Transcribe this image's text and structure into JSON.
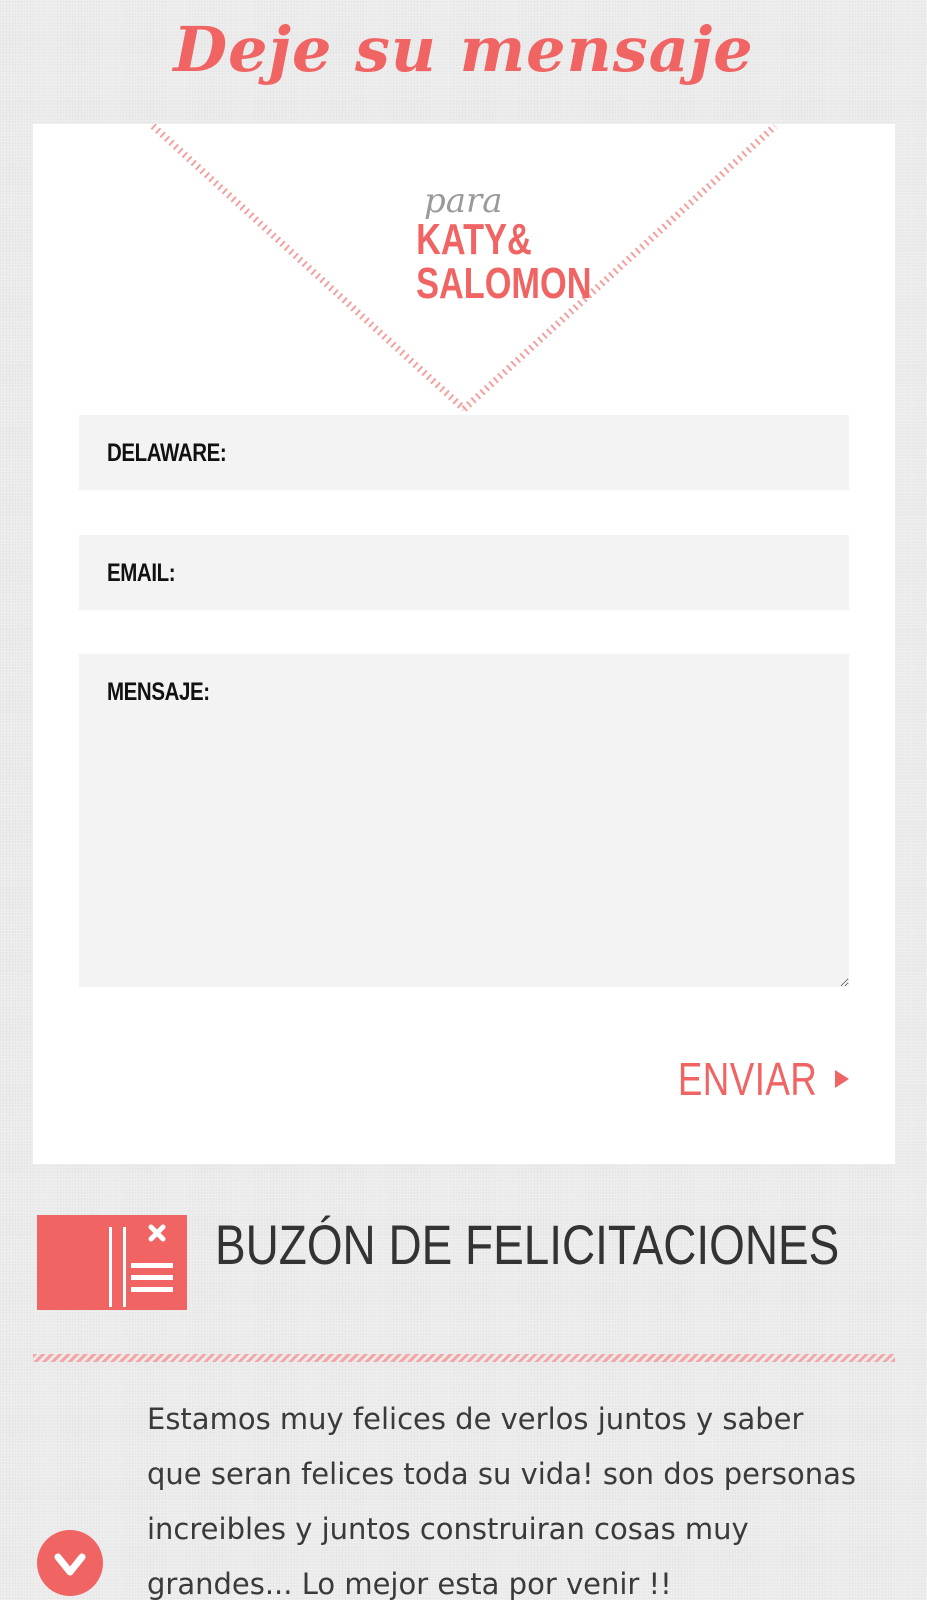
{
  "page": {
    "title": "Deje su mensaje"
  },
  "logo": {
    "para": "para",
    "line1": "KATY&",
    "line2": "SALOMON"
  },
  "form": {
    "name_label": "DELAWARE:",
    "email_label": "EMAIL:",
    "message_label": "MENSAJE:",
    "submit_label": "ENVIAR"
  },
  "mailbox": {
    "title": "BUZÓN DE FELICITACIONES",
    "icon": "mailbox-icon"
  },
  "messages": [
    {
      "text": "Estamos muy felices de verlos juntos y saber que seran felices toda su vida! son dos personas increibles y juntos construiran cosas muy grandes... Lo mejor esta por venir !!",
      "icon": "heart-icon"
    }
  ],
  "colors": {
    "accent": "#f06464",
    "field_bg": "#f3f3f3",
    "card_bg": "#ffffff",
    "page_bg": "#ebebeb"
  }
}
